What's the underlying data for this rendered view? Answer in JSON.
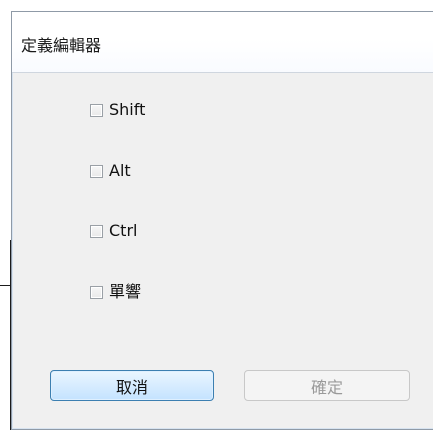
{
  "window": {
    "title": "定義編輯器"
  },
  "options": [
    {
      "label": "Shift",
      "checked": false
    },
    {
      "label": "Alt",
      "checked": false
    },
    {
      "label": "Ctrl",
      "checked": false
    },
    {
      "label": "單響",
      "checked": false
    }
  ],
  "buttons": {
    "cancel_label": "取消",
    "ok_label": "確定"
  }
}
